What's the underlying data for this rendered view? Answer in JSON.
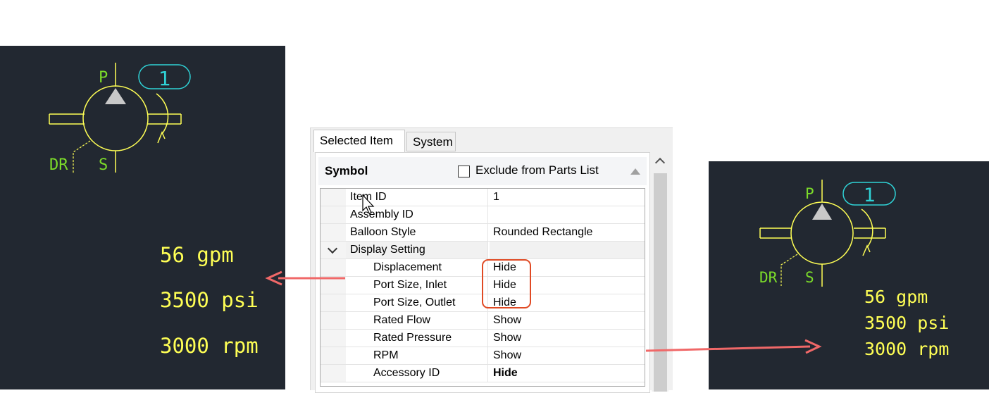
{
  "left_drawing": {
    "port_p": "P",
    "port_dr": "DR",
    "port_s": "S",
    "balloon_number": "1",
    "flow": "56 gpm",
    "pressure": "3500 psi",
    "speed": "3000 rpm"
  },
  "right_drawing": {
    "port_p": "P",
    "port_dr": "DR",
    "port_s": "S",
    "balloon_number": "1",
    "flow": "56 gpm",
    "pressure": "3500 psi",
    "speed": "3000 rpm"
  },
  "panel": {
    "tabs": [
      "Selected Item",
      "System"
    ],
    "section_title": "Symbol",
    "exclude_label": "Exclude from Parts List",
    "exclude_checked": false,
    "rows": [
      {
        "name": "Item ID",
        "value": "1"
      },
      {
        "name": "Assembly ID",
        "value": ""
      },
      {
        "name": "Balloon Style",
        "value": "Rounded Rectangle"
      },
      {
        "name": "Display Setting",
        "value": ""
      },
      {
        "name": "Displacement",
        "value": "Hide"
      },
      {
        "name": "Port Size, Inlet",
        "value": "Hide"
      },
      {
        "name": "Port Size, Outlet",
        "value": "Hide"
      },
      {
        "name": "Rated Flow",
        "value": "Show"
      },
      {
        "name": "Rated Pressure",
        "value": "Show"
      },
      {
        "name": "RPM",
        "value": "Show"
      },
      {
        "name": "Accessory ID",
        "value": "Hide"
      }
    ]
  },
  "colors": {
    "canvas_bg": "#222831",
    "symbol_yellow": "#ffff55",
    "port_label_green": "#7cdc2a",
    "balloon_cyan": "#2fd2d6",
    "highlight_orange": "#e04a24",
    "arrow_coral": "#f06868"
  }
}
